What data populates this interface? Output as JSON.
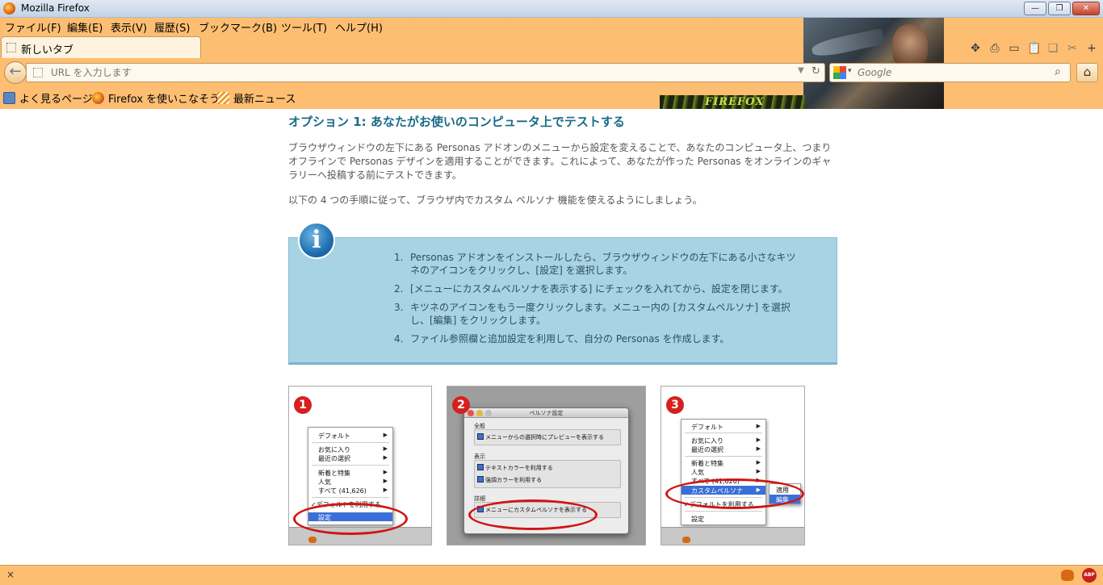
{
  "window": {
    "title": "Mozilla Firefox"
  },
  "menubar": [
    "ファイル(F)",
    "編集(E)",
    "表示(V)",
    "履歴(S)",
    "ブックマーク(B)",
    "ツール(T)",
    "ヘルプ(H)"
  ],
  "tab": {
    "label": "新しいタブ"
  },
  "navbar": {
    "url_placeholder": "URL を入力します",
    "search_placeholder": "Google"
  },
  "bookmarks": [
    "よく見るページ",
    "Firefox を使いこなそう",
    "最新ニュース"
  ],
  "persona": {
    "banner_text": "FIREFOX"
  },
  "content": {
    "heading": "オプション 1: あなたがお使いのコンピュータ上でテストする",
    "para1": "ブラウザウィンドウの左下にある Personas アドオンのメニューから設定を変えることで、あなたのコンピュータ上、つまりオフラインで Personas デザインを適用することができます。これによって、あなたが作った Personas をオンラインのギャラリーへ投稿する前にテストできます。",
    "para2": "以下の 4 つの手順に従って、ブラウザ内でカスタム ペルソナ 機能を使えるようにしましょう。",
    "info_icon": "i",
    "steps": [
      {
        "num": "1.",
        "text": "Personas アドオンをインストールしたら、ブラウザウィンドウの左下にある小さなキツネのアイコンをクリックし、[設定] を選択します。"
      },
      {
        "num": "2.",
        "text": "[メニューにカスタムペルソナを表示する] にチェックを入れてから、設定を閉じます。"
      },
      {
        "num": "3.",
        "text": "キツネのアイコンをもう一度クリックします。メニュー内の [カスタムペルソナ] を選択し、[編集] をクリックします。"
      },
      {
        "num": "4.",
        "text": "ファイル参照欄と追加設定を利用して、自分の Personas を作成します。"
      }
    ],
    "shot1": {
      "badge": "1",
      "items": [
        "デフォルト",
        "お気に入り",
        "最近の選択",
        "新着と特集",
        "人気",
        "すべて (41,626)",
        "✓デフォルトを利用する",
        "設定"
      ]
    },
    "shot2": {
      "badge": "2",
      "title": "ペルソナ設定",
      "group1": "全般",
      "check1": "メニューからの選択時にプレビューを表示する",
      "group2": "表示",
      "check2": "テキストカラーを利用する",
      "check3": "強調カラーを利用する",
      "group3": "詳細",
      "check4": "メニューにカスタムペルソナを表示する"
    },
    "shot3": {
      "badge": "3",
      "items": [
        "デフォルト",
        "お気に入り",
        "最近の選択",
        "新着と特集",
        "人気",
        "すべて (41,626)",
        "カスタムペルソナ",
        "✓デフォルトを利用する",
        "設定"
      ],
      "submenu": [
        "適用",
        "編集"
      ]
    }
  },
  "statusbar": {
    "close": "×",
    "abp": "ABP"
  }
}
